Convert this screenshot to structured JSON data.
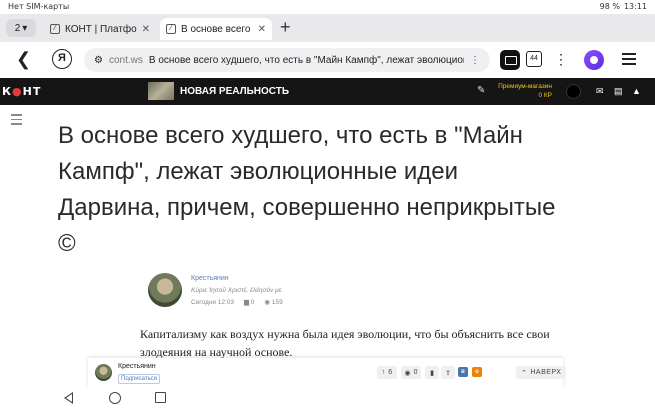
{
  "status_bar": {
    "carrier": "Нет SIM-карты",
    "battery": "98 %",
    "time": "13:11"
  },
  "tabs": {
    "count": "2",
    "items": [
      {
        "title": "КОНТ | Платформа",
        "active": false
      },
      {
        "title": "В основе всего ху",
        "active": true
      }
    ],
    "close_glyph": "✕",
    "new_tab_glyph": "+"
  },
  "address_bar": {
    "yandex_letter": "Я",
    "domain": "cont.ws",
    "page_title": "В основе всего худшего, что есть в \"Майн Кампф\", лежат эволюционные идеи",
    "tabs_count": "44"
  },
  "site_header": {
    "logo_prefix": "К",
    "logo_dot": "●",
    "logo_suffix": "НТ",
    "channel_name": "НОВАЯ РЕАЛЬНОСТЬ",
    "premium_label": "Премиум-магазин",
    "premium_balance": "0 КР"
  },
  "article": {
    "title": "В основе всего худшего, что есть в \"Майн Кампф\", лежат эволюционные идеи Дарвина, причем, совершенно неприкрытые ©",
    "author": {
      "name": "Крестьянин",
      "motto": "Κύριε Ἰησοῦ Χριστέ, ἐλέησόν με",
      "date": "Сегодня 12:03",
      "comments": "0",
      "views": "159"
    },
    "body": "Капитализму как воздух нужна была идея эволюции, что бы объяснить все свои злодеяния на научной основе."
  },
  "sticky_bar": {
    "author_name": "Крестьянин",
    "subscribed_label": "Подписаться",
    "upvotes": "6",
    "comments": "0",
    "next_label": "НАВЕРХ",
    "social_colors": {
      "vk": "#4a76a8",
      "ok": "#ee8208"
    }
  }
}
